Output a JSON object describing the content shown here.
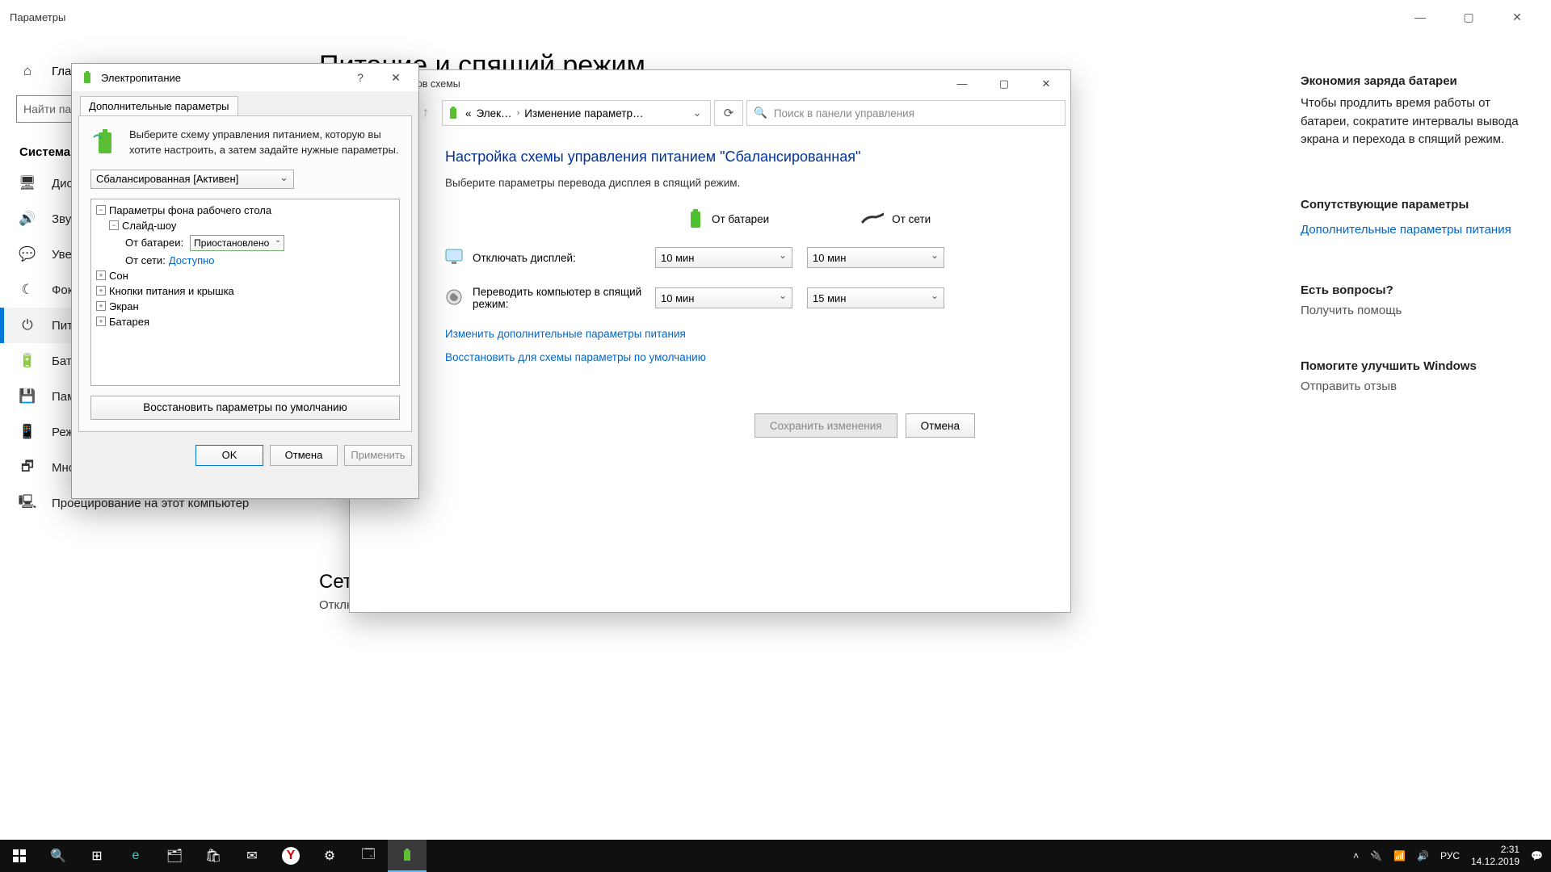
{
  "settings": {
    "title": "Параметры",
    "home_label": "Главная",
    "search_placeholder": "Найти параметр",
    "category": "Система",
    "items": [
      {
        "icon": "🖥",
        "label": "Дисплей"
      },
      {
        "icon": "🔊",
        "label": "Звук"
      },
      {
        "icon": "💬",
        "label": "Уведомления"
      },
      {
        "icon": "☾",
        "label": "Фокусировка"
      },
      {
        "icon": "⏻",
        "label": "Питание и спящий режим"
      },
      {
        "icon": "🔋",
        "label": "Батарея"
      },
      {
        "icon": "💾",
        "label": "Память устройства"
      },
      {
        "icon": "📱",
        "label": "Режим планшета"
      },
      {
        "icon": "🗗",
        "label": "Многозадачность"
      },
      {
        "icon": "🖳",
        "label": "Проецирование на этот компьютер"
      }
    ],
    "active_index": 4,
    "page_h1": "Питание и спящий режим",
    "section_network": "Сетевое подключение",
    "network_text": "Отключать от сети в спящем режиме при работе от батареи"
  },
  "right": {
    "h1": "Экономия заряда батареи",
    "p1": "Чтобы продлить время работы от батареи, сократите интервалы вывода экрана и перехода в спящий режим.",
    "link1": "Сопутствующие параметры",
    "link2": "Дополнительные параметры питания",
    "q": "Есть вопросы?",
    "help": "Получить помощь",
    "improve": "Помогите улучшить Windows",
    "feedback": "Отправить отзыв"
  },
  "cpl": {
    "title": "ие параметров схемы",
    "bc_root": "«",
    "bc1": "Элек…",
    "bc2": "Изменение параметр…",
    "search_placeholder": "Поиск в панели управления",
    "h1": "Настройка схемы управления питанием \"Сбалансированная\"",
    "sub": "Выберите параметры перевода дисплея в спящий режим.",
    "col_batt": "От батареи",
    "col_ac": "От сети",
    "row_display": "Отключать дисплей:",
    "row_sleep": "Переводить компьютер в спящий режим:",
    "display_batt": "10 мин",
    "display_ac": "10 мин",
    "sleep_batt": "10 мин",
    "sleep_ac": "15 мин",
    "link_adv": "Изменить дополнительные параметры питания",
    "link_restore": "Восстановить для схемы параметры по умолчанию",
    "save": "Сохранить изменения",
    "cancel": "Отмена"
  },
  "adv": {
    "title": "Электропитание",
    "tab": "Дополнительные параметры",
    "intro": "Выберите схему управления питанием, которую вы хотите настроить, а затем задайте нужные параметры.",
    "scheme_value": "Сбалансированная [Активен]",
    "tree": {
      "params_bg": "Параметры фона рабочего стола",
      "slideshow": "Слайд-шоу",
      "on_batt_lab": "От батареи:",
      "on_batt_val": "Приостановлено",
      "on_ac_lab": "От сети:",
      "on_ac_val": "Доступно",
      "sleep": "Сон",
      "buttons": "Кнопки питания и крышка",
      "screen": "Экран",
      "battery": "Батарея"
    },
    "restore": "Восстановить параметры по умолчанию",
    "ok": "OK",
    "cancel": "Отмена",
    "apply": "Применить"
  },
  "taskbar": {
    "lang": "РУС",
    "time": "2:31",
    "date": "14.12.2019"
  }
}
